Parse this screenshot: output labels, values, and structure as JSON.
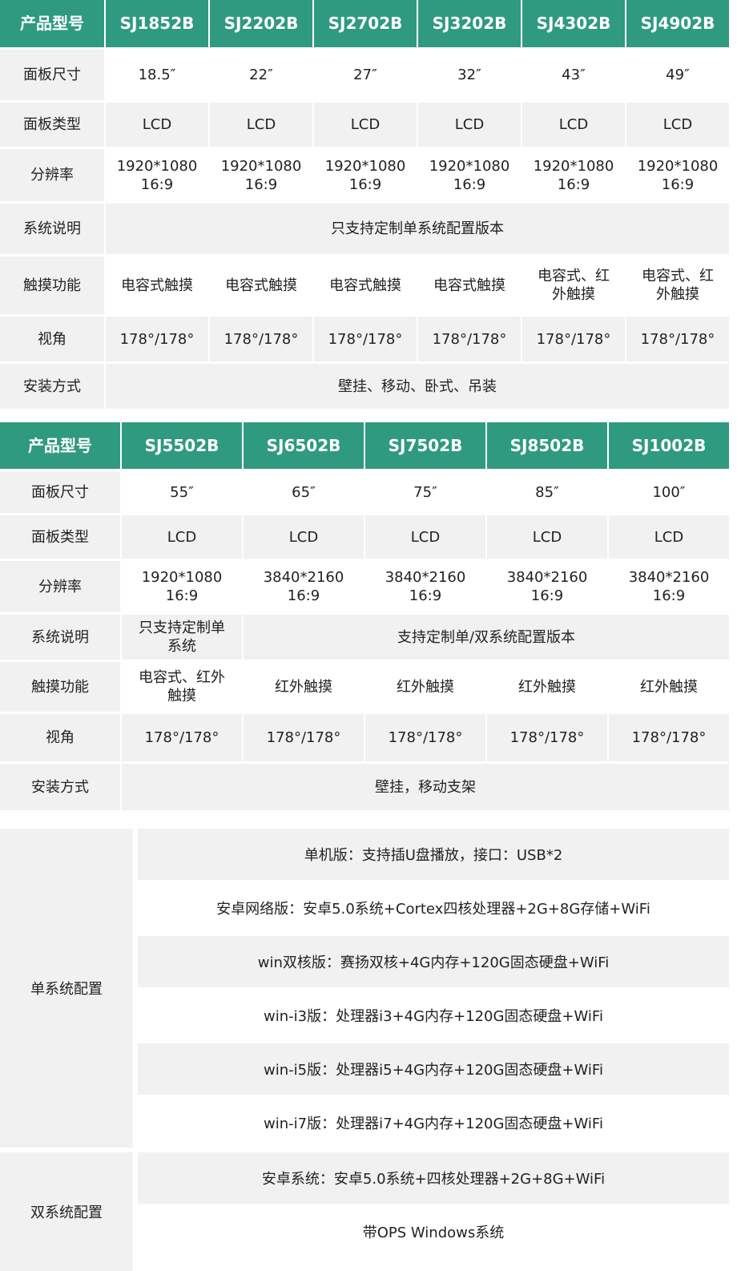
{
  "table1": {
    "header": {
      "label": "产品型号",
      "models": [
        "SJ1852B",
        "SJ2202B",
        "SJ2702B",
        "SJ3202B",
        "SJ4302B",
        "SJ4902B"
      ]
    },
    "panel_size": {
      "label": "面板尺寸",
      "values": [
        "18.5″",
        "22″",
        "27″",
        "32″",
        "43″",
        "49″"
      ]
    },
    "panel_type": {
      "label": "面板类型",
      "values": [
        "LCD",
        "LCD",
        "LCD",
        "LCD",
        "LCD",
        "LCD"
      ]
    },
    "resolution": {
      "label": "分辨率",
      "values": [
        [
          "1920*1080",
          "16:9"
        ],
        [
          "1920*1080",
          "16:9"
        ],
        [
          "1920*1080",
          "16:9"
        ],
        [
          "1920*1080",
          "16:9"
        ],
        [
          "1920*1080",
          "16:9"
        ],
        [
          "1920*1080",
          "16:9"
        ]
      ]
    },
    "system": {
      "label": "系统说明",
      "value": "只支持定制单系统配置版本"
    },
    "touch": {
      "label": "触摸功能",
      "values": [
        [
          "电容式触摸"
        ],
        [
          "电容式触摸"
        ],
        [
          "电容式触摸"
        ],
        [
          "电容式触摸"
        ],
        [
          "电容式、红",
          "外触摸"
        ],
        [
          "电容式、红",
          "外触摸"
        ]
      ]
    },
    "view_angle": {
      "label": "视角",
      "values": [
        "178°/178°",
        "178°/178°",
        "178°/178°",
        "178°/178°",
        "178°/178°",
        "178°/178°"
      ]
    },
    "install": {
      "label": "安装方式",
      "value": "壁挂、移动、卧式、吊装"
    }
  },
  "table2": {
    "header": {
      "label": "产品型号",
      "models": [
        "SJ5502B",
        "SJ6502B",
        "SJ7502B",
        "SJ8502B",
        "SJ1002B"
      ]
    },
    "panel_size": {
      "label": "面板尺寸",
      "values": [
        "55″",
        "65″",
        "75″",
        "85″",
        "100″"
      ]
    },
    "panel_type": {
      "label": "面板类型",
      "values": [
        "LCD",
        "LCD",
        "LCD",
        "LCD",
        "LCD"
      ]
    },
    "resolution": {
      "label": "分辨率",
      "values": [
        [
          "1920*1080",
          "16:9"
        ],
        [
          "3840*2160",
          "16:9"
        ],
        [
          "3840*2160",
          "16:9"
        ],
        [
          "3840*2160",
          "16:9"
        ],
        [
          "3840*2160",
          "16:9"
        ]
      ]
    },
    "system": {
      "label": "系统说明",
      "first": [
        "只支持定制单",
        "系统"
      ],
      "rest": "支持定制单/双系统配置版本"
    },
    "touch": {
      "label": "触摸功能",
      "values": [
        [
          "电容式、红外",
          "触摸"
        ],
        [
          "红外触摸"
        ],
        [
          "红外触摸"
        ],
        [
          "红外触摸"
        ],
        [
          "红外触摸"
        ]
      ]
    },
    "view_angle": {
      "label": "视角",
      "values": [
        "178°/178°",
        "178°/178°",
        "178°/178°",
        "178°/178°",
        "178°/178°"
      ]
    },
    "install": {
      "label": "安装方式",
      "value": "壁挂，移动支架"
    }
  },
  "config": {
    "single": {
      "label": "单系统配置",
      "items": [
        "单机版：支持插U盘播放，接口：USB*2",
        "安卓网络版：安卓5.0系统+Cortex四核处理器+2G+8G存储+WiFi",
        "win双核版：赛扬双核+4G内存+120G固态硬盘+WiFi",
        "win-i3版：处理器i3+4G内存+120G固态硬盘+WiFi",
        "win-i5版：处理器i5+4G内存+120G固态硬盘+WiFi",
        "win-i7版：处理器i7+4G内存+120G固态硬盘+WiFi"
      ]
    },
    "dual": {
      "label": "双系统配置",
      "items": [
        "安卓系统：安卓5.0系统+四核处理器+2G+8G+WiFi",
        "带OPS Windows系统"
      ]
    }
  }
}
